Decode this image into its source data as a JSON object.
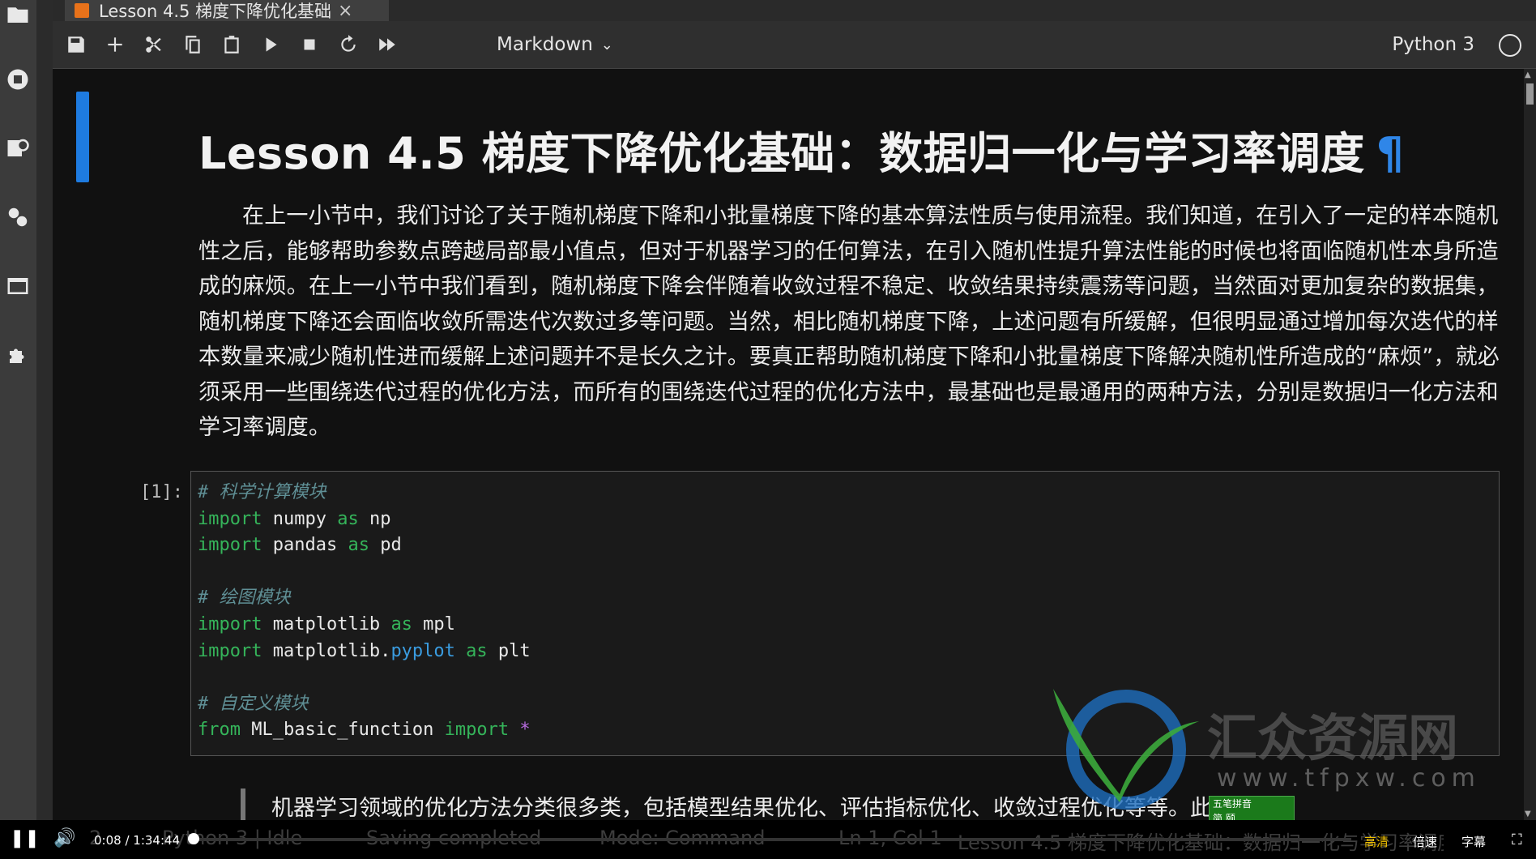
{
  "tab": {
    "title": "Lesson 4.5 梯度下降优化基础",
    "close": "×"
  },
  "toolbar": {
    "cell_type": "Markdown",
    "kernel": "Python 3",
    "buttons": [
      "save-icon",
      "plus-icon",
      "scissors-icon",
      "copy-icon",
      "paste-icon",
      "play-icon",
      "stop-icon",
      "restart-icon",
      "fast-forward-icon"
    ]
  },
  "sidebar": {
    "icons": [
      "folder-icon",
      "running-icon",
      "commands-icon",
      "property-inspector-icon",
      "tabs-icon",
      "extension-icon"
    ]
  },
  "notebook": {
    "heading": "Lesson 4.5 梯度下降优化基础：数据归一化与学习率调度",
    "anchor": "¶",
    "paragraph_lines": [
      "在上一小节中，我们讨论了关于随机梯度下降和小批量梯度下降的基本算法性质与使用流程。我们知道，在引入了一定的样本",
      "随机性之后，能够帮助参数点跨越局部最小值点，但对于机器学习的任何算法，在引入随机性提升算法性能的时候也将面临随机性",
      "本身所造成的麻烦。在上一小节中我们看到，随机梯度下降会伴随着收敛过程不稳定、收敛结果持续震荡等问题，当然面对更加复",
      "杂的数据集，随机梯度下降还会面临收敛所需迭代次数过多等问题。当然，相比随机梯度下降，上述问题有所缓解，但很明显通过",
      "增加每次迭代的样本数量来减少随机性进而缓解上述问题并不是长久之计。要真正帮助随机梯度下降和小批量梯度下降解决随机性",
      "所造成的“麻烦”，就必须采用一些围绕迭代过程的优化方法，而所有的围绕迭代过程的优化方法中，最基础也是最通用的两种方法，",
      "分别是数据归一化方法和学习率调度。"
    ],
    "code_prompt": "[1]:",
    "code": {
      "c1": "# 科学计算模块",
      "l1_kw": "import",
      "l1_mod": " numpy ",
      "l1_as": "as",
      "l1_al": " np",
      "l2_kw": "import",
      "l2_mod": " pandas ",
      "l2_as": "as",
      "l2_al": " pd",
      "c2": "# 绘图模块",
      "l3_kw": "import",
      "l3_mod": " matplotlib ",
      "l3_as": "as",
      "l3_al": " mpl",
      "l4_kw": "import",
      "l4_mod": " matplotlib.",
      "l4_attr": "pyplot",
      "l4_sp": " ",
      "l4_as": "as",
      "l4_al": " plt",
      "c3": "# 自定义模块",
      "l5_from": "from",
      "l5_mod": " ML_basic_function ",
      "l5_imp": "import",
      "l5_star": " *"
    },
    "next_line": "机器学习领域的优化方法分类很多类，包括模型结果优化、评估指标优化、收敛过程优化等等。此"
  },
  "watermark": {
    "text": "汇众资源网",
    "url": "www.tfpxw.com"
  },
  "ime": {
    "line1": "五笔拼音",
    "line2": "简 颐"
  },
  "statusbar": {
    "count": "2",
    "kernel": "Python 3 | Idle",
    "saving": "Saving completed",
    "mode": "Mode: Command",
    "position": "Ln 1, Col 1",
    "file": "Lesson 4.5 梯度下降优化基础：数据归一化与学习率调度.ipynb"
  },
  "player": {
    "time": "0:08 / 1:34:44",
    "progress": 0.0014,
    "quality": "高清",
    "speed": "倍速",
    "subtitle": "字幕"
  }
}
